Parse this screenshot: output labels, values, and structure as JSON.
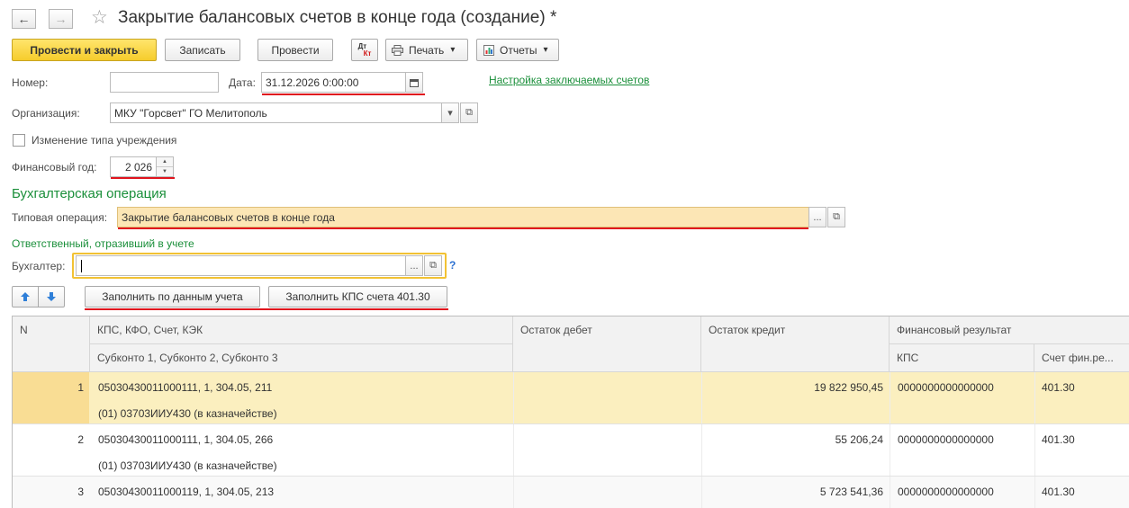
{
  "window": {
    "title": "Закрытие балансовых счетов в конце года (создание) *",
    "back_glyph": "←",
    "forward_glyph": "→",
    "star_glyph": "☆"
  },
  "toolbar": {
    "post_close": "Провести и закрыть",
    "save": "Записать",
    "post": "Провести",
    "dt_kt_top": "Дт",
    "dt_kt_bottom": "Кт",
    "print": "Печать",
    "reports": "Отчеты",
    "dropdown_glyph": "▾"
  },
  "form": {
    "number_label": "Номер:",
    "number_value": "",
    "date_label": "Дата:",
    "date_value": "31.12.2026  0:00:00",
    "settings_link": "Настройка заключаемых счетов",
    "org_label": "Организация:",
    "org_value": "МКУ \"Горсвет\" ГО Мелитополь",
    "change_type_label": "Изменение типа учреждения",
    "change_type_checked": false,
    "fin_year_label": "Финансовый год:",
    "fin_year_value": "2 026",
    "op_section_title": "Бухгалтерская операция",
    "typical_op_label": "Типовая операция:",
    "typical_op_value": "Закрытие балансовых счетов в конце года",
    "responsible_title": "Ответственный, отразивший в учете",
    "accountant_label": "Бухгалтер:",
    "accountant_value": "",
    "help_glyph": "?",
    "ellipsis": "...",
    "open_glyph": "⧉",
    "select_glyph": "▾"
  },
  "table_toolbar": {
    "up_glyph": "🡅",
    "down_glyph": "🡇",
    "fill_by_accounting": "Заполнить по данным учета",
    "fill_kps": "Заполнить КПС счета 401.30"
  },
  "table": {
    "headers": {
      "n": "N",
      "kps": "КПС, КФО, Счет, КЭК",
      "subkonto": "Субконто 1, Субконто 2, Субконто 3",
      "debit": "Остаток дебет",
      "credit": "Остаток кредит",
      "fin_result": "Финансовый результат",
      "fin_kps": "КПС",
      "fin_account": "Счет фин.ре..."
    },
    "rows": [
      {
        "n": "1",
        "kps": "05030430011000111, 1, 304.05, 211",
        "sub": "(01) 03703ИИУ430 (в казначействе)",
        "debit": "",
        "credit": "19 822 950,45",
        "fin_kps": "0000000000000000",
        "fin_account": "401.30"
      },
      {
        "n": "2",
        "kps": "05030430011000111, 1, 304.05, 266",
        "sub": "(01) 03703ИИУ430 (в казначействе)",
        "debit": "",
        "credit": "55 206,24",
        "fin_kps": "0000000000000000",
        "fin_account": "401.30"
      },
      {
        "n": "3",
        "kps": "05030430011000119, 1, 304.05, 213",
        "sub": "",
        "debit": "",
        "credit": "5 723 541,36",
        "fin_kps": "0000000000000000",
        "fin_account": "401.30"
      }
    ]
  },
  "colors": {
    "accent_green": "#1a8f3a",
    "primary_button": "#f6cc2c",
    "highlight_underline": "#e0141e",
    "selected_row": "#fbefbf"
  }
}
